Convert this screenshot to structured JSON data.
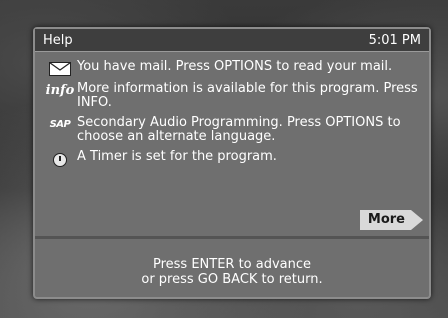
{
  "header": {
    "title": "Help",
    "time": "5:01 PM"
  },
  "items": [
    {
      "icon": "mail-icon",
      "text": "You have mail.  Press OPTIONS to read your mail."
    },
    {
      "icon": "info-icon",
      "icon_text": "info",
      "text": "More information is available for this program.  Press INFO."
    },
    {
      "icon": "sap-icon",
      "icon_text": "SAP",
      "text": "Secondary Audio Programming.  Press OPTIONS to choose an alternate language."
    },
    {
      "icon": "timer-icon",
      "text": "A Timer is set for the program."
    }
  ],
  "more_label": "More",
  "footer": {
    "line1": "Press ENTER to advance",
    "line2": "or press GO BACK to return."
  }
}
